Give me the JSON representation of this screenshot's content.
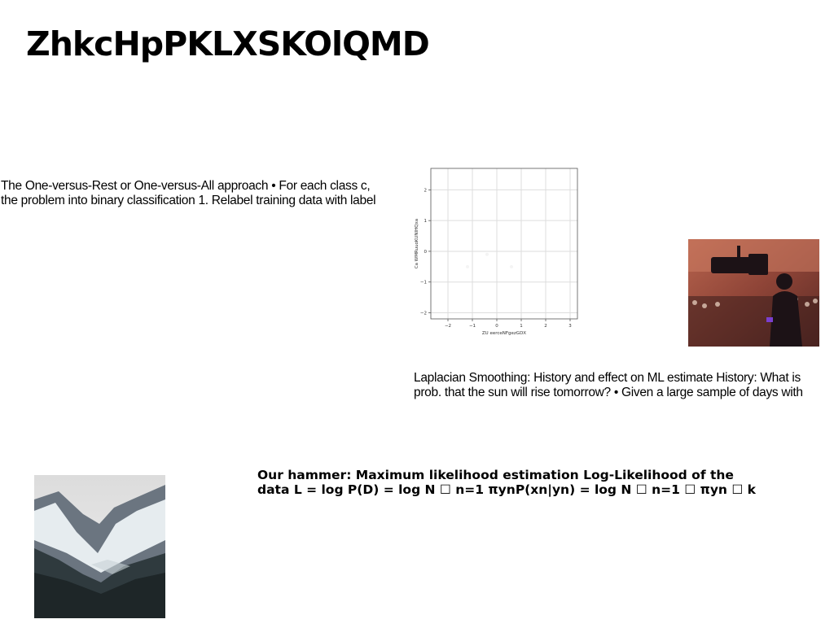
{
  "slide": {
    "title": "ZhkcHpPKLXSKOlQMD",
    "para_ovr": [
      "The One-versus-Rest or One-versus-All approach • For each class c,",
      "the problem into binary classification 1. Relabel training data with label"
    ],
    "para_laplace": [
      "Laplacian Smoothing: History and effect on ML estimate History: What is",
      "prob. that the sun will rise tomorrow? • Given a large sample of days with"
    ],
    "para_hammer": [
      "Our hammer: Maximum likelihood estimation Log-Likelihood of the",
      "data L = log P(D) = log N ☐ n=1 πynP(xn|yn) = log N ☐ n=1 ☐ πyn ☐ k"
    ],
    "images": {
      "camera_photo": "camera-operator-photo",
      "mountain_photo": "snowy-mountain-photo"
    }
  },
  "chart_data": {
    "type": "scatter",
    "xlabel": "ZU eerceNFgezGDX",
    "ylabel": "Ca WMRuuoKUNIHQxa",
    "xlim": [
      -2.7,
      3.3
    ],
    "ylim": [
      -2.2,
      2.7
    ],
    "xticks": [
      -2,
      -1,
      0,
      1,
      2,
      3
    ],
    "yticks": [
      -2,
      -1,
      0,
      1,
      2
    ],
    "x_tick_labels": [
      "−2",
      "−1",
      "0",
      "1",
      "2",
      "3"
    ],
    "y_tick_labels": [
      "−2",
      "−1",
      "0",
      "1",
      "2"
    ],
    "grid": true,
    "series": [
      {
        "points": [
          [
            -1.2,
            -0.5
          ],
          [
            -0.4,
            -0.1
          ],
          [
            0.6,
            -0.5
          ]
        ],
        "color": "#f4f4f4"
      }
    ]
  }
}
